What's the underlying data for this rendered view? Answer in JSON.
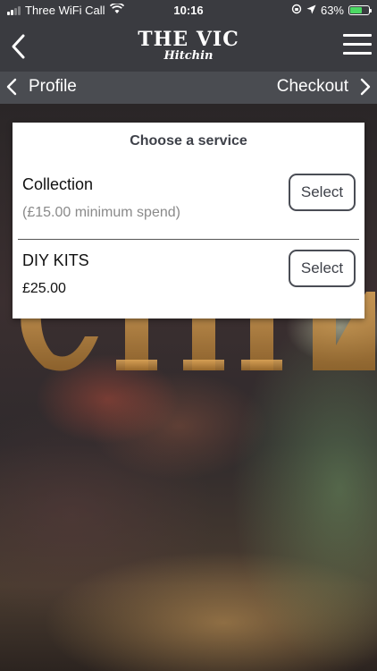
{
  "status_bar": {
    "carrier": "Three WiFi Call",
    "time": "10:16",
    "battery_percent": "63%",
    "battery_level": 0.63,
    "battery_color": "#4cd964"
  },
  "header": {
    "logo_main": "THE VIC",
    "logo_sub": "Hitchin",
    "back_icon": "chevron-left-icon",
    "menu_icon": "hamburger-menu-icon"
  },
  "sub_nav": {
    "prev_label": "Profile",
    "next_label": "Checkout"
  },
  "dialog": {
    "title": "Choose a service",
    "services": [
      {
        "name": "Collection",
        "detail": "(£15.00 minimum spend)",
        "detail_color": "#8a8a8a",
        "button_label": "Select"
      },
      {
        "name": "DIY KITS",
        "detail": "£25.00",
        "detail_color": "#111111",
        "button_label": "Select"
      }
    ]
  }
}
